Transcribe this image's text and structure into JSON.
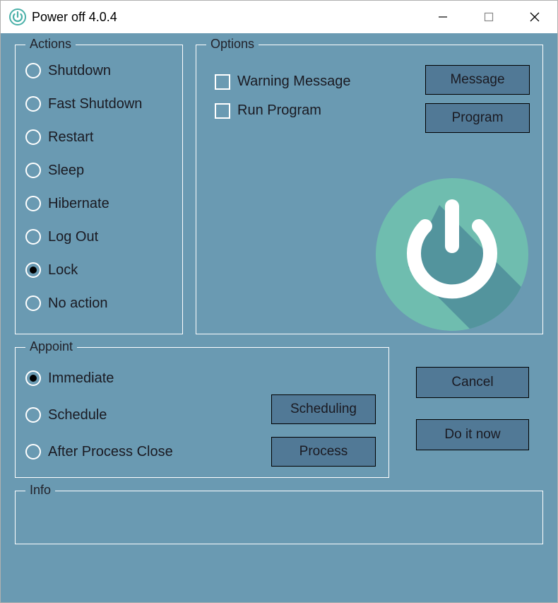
{
  "window": {
    "title": "Power off 4.0.4"
  },
  "actions": {
    "legend": "Actions",
    "items": [
      {
        "label": "Shutdown",
        "selected": false
      },
      {
        "label": "Fast Shutdown",
        "selected": false
      },
      {
        "label": "Restart",
        "selected": false
      },
      {
        "label": "Sleep",
        "selected": false
      },
      {
        "label": "Hibernate",
        "selected": false
      },
      {
        "label": "Log Out",
        "selected": false
      },
      {
        "label": "Lock",
        "selected": true
      },
      {
        "label": "No action",
        "selected": false
      }
    ]
  },
  "options": {
    "legend": "Options",
    "checks": [
      {
        "label": "Warning Message",
        "checked": false
      },
      {
        "label": "Run Program",
        "checked": false
      }
    ],
    "buttons": {
      "message": "Message",
      "program": "Program"
    }
  },
  "appoint": {
    "legend": "Appoint",
    "items": [
      {
        "label": "Immediate",
        "selected": true
      },
      {
        "label": "Schedule",
        "selected": false
      },
      {
        "label": "After Process Close",
        "selected": false
      }
    ],
    "buttons": {
      "scheduling": "Scheduling",
      "process": "Process"
    }
  },
  "mainButtons": {
    "cancel": "Cancel",
    "doit": "Do it now"
  },
  "info": {
    "legend": "Info"
  },
  "colors": {
    "bg": "#6a9ab2",
    "button": "#517996",
    "logoCircle": "#6fbdaf",
    "logoShadow": "#4f8d9a"
  }
}
